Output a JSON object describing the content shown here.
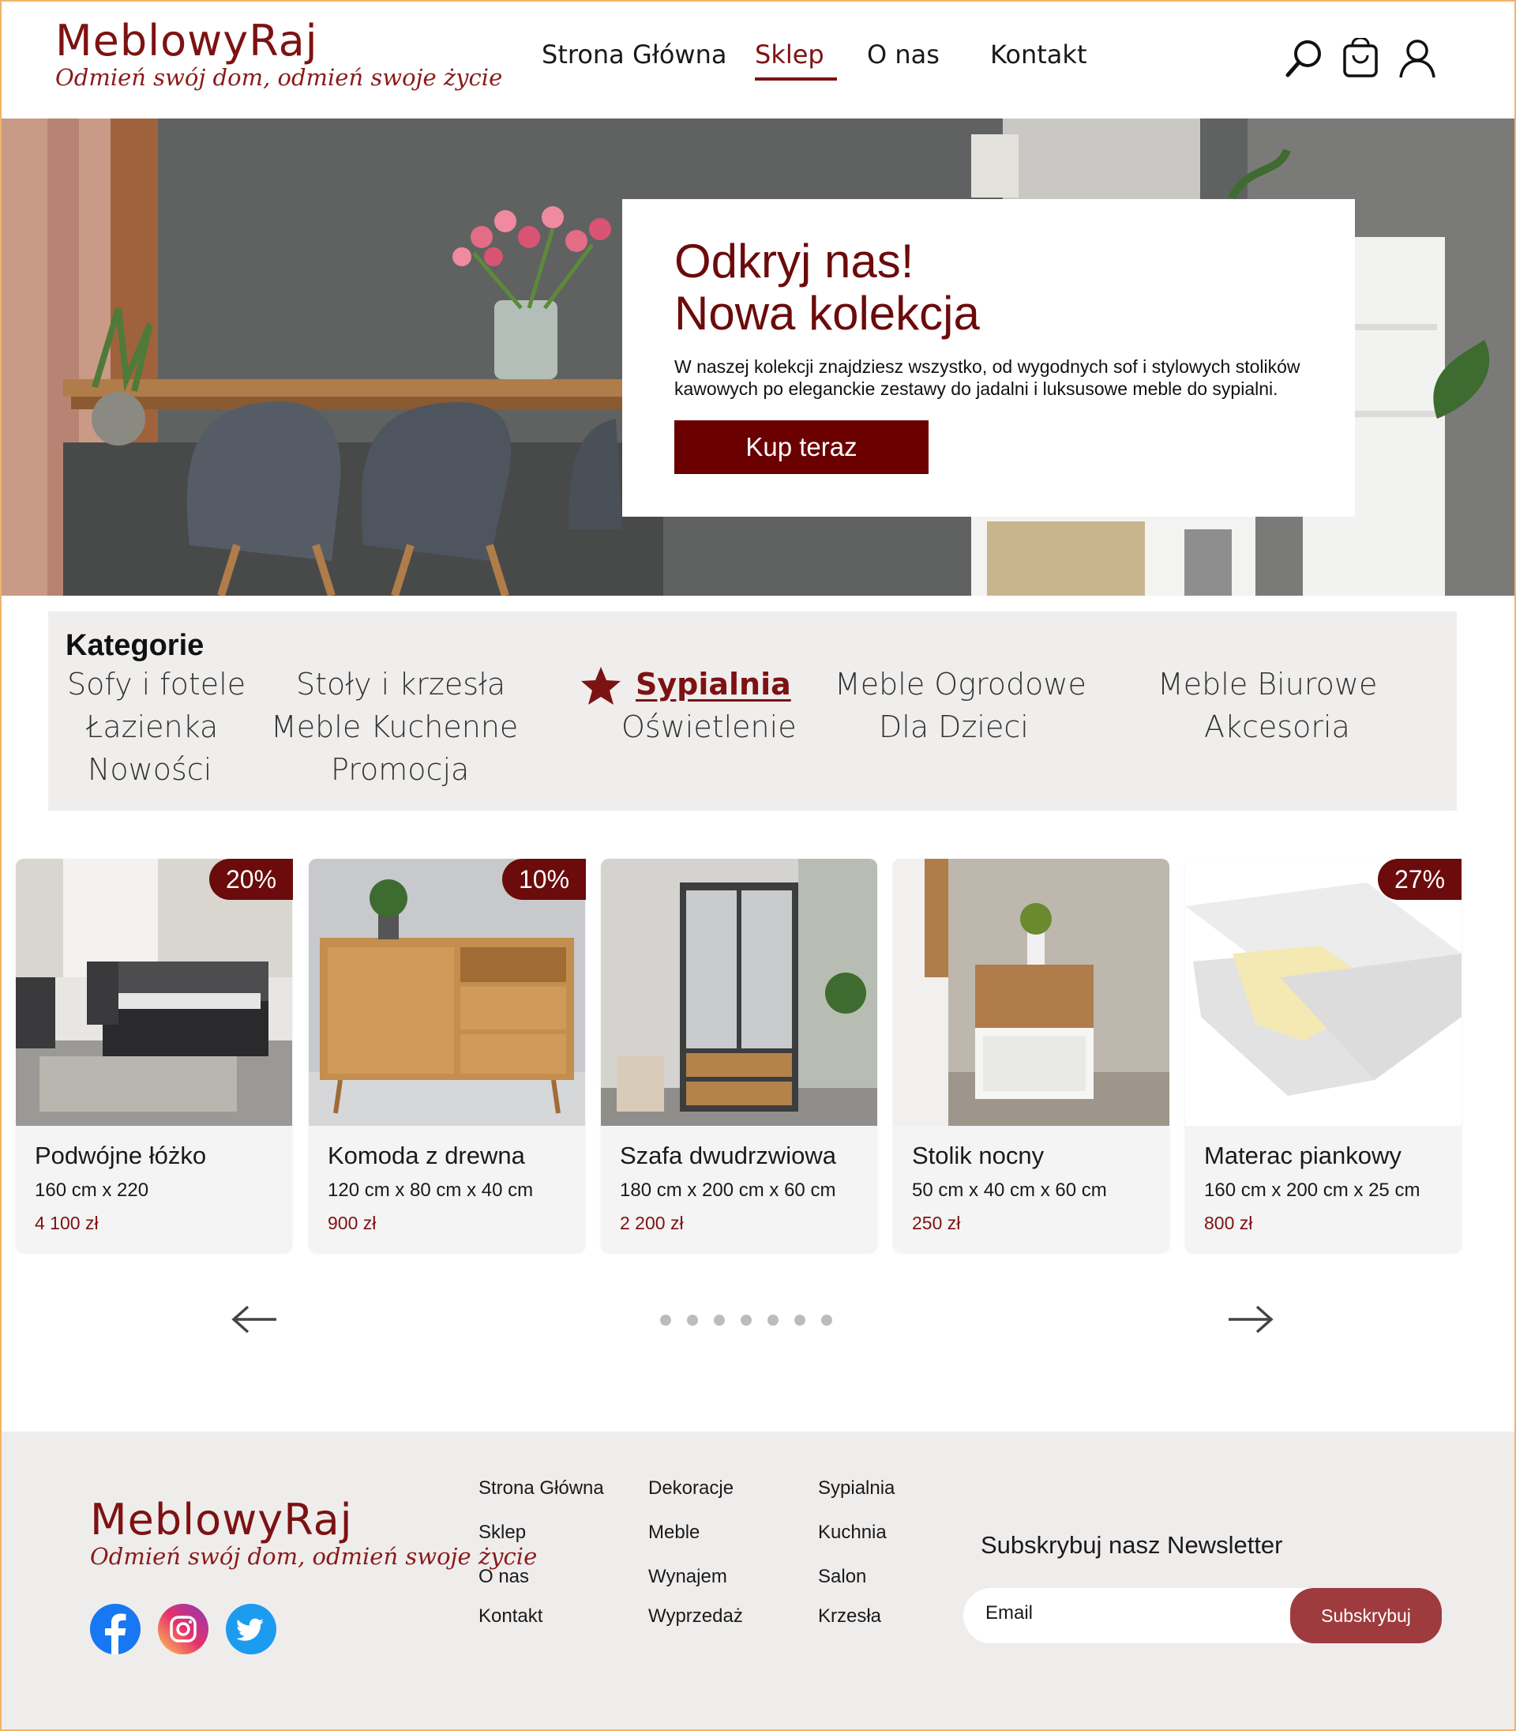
{
  "brand": {
    "name": "MeblowyRaj",
    "tagline": "Odmień swój dom, odmień swoje życie",
    "accent": "#7d1212"
  },
  "nav": {
    "items": [
      "Strona Główna",
      "Sklep",
      "O nas",
      "Kontakt"
    ],
    "active": "Sklep"
  },
  "header_icons": [
    "search-icon",
    "cart-icon",
    "user-icon"
  ],
  "hero": {
    "title_line1": "Odkryj nas!",
    "title_line2": "Nowa kolekcja",
    "text": "W naszej kolekcji znajdziesz wszystko, od wygodnych sof i stylowych stolików kawowych po eleganckie zestawy do jadalni i luksusowe meble do sypialni.",
    "button": "Kup teraz"
  },
  "categories": {
    "title": "Kategorie",
    "items": [
      "Sofy i fotele",
      "Stoły i krzesła",
      "Sypialnia",
      "Meble Ogrodowe",
      "Meble Biurowe",
      "Łazienka",
      "Meble Kuchenne",
      "Oświetlenie",
      "Dla Dzieci",
      "Akcesoria",
      "Nowości",
      "Promocja"
    ],
    "active": "Sypialnia"
  },
  "products": [
    {
      "name": "Podwójne łóżko",
      "dims": "160 cm x 220",
      "price": "4 100 zł",
      "discount": "20%"
    },
    {
      "name": "Komoda z drewna",
      "dims": "120 cm x 80 cm x 40 cm",
      "price": "900 zł",
      "discount": "10%"
    },
    {
      "name": "Szafa dwudrzwiowa",
      "dims": "180 cm x 200 cm x 60 cm",
      "price": "2 200 zł",
      "discount": ""
    },
    {
      "name": "Stolik nocny",
      "dims": "50 cm x 40 cm x 60 cm",
      "price": "250 zł",
      "discount": ""
    },
    {
      "name": "Materac piankowy",
      "dims": "160 cm x 200 cm x 25 cm",
      "price": "800 zł",
      "discount": "27%"
    }
  ],
  "carousel": {
    "dots": 7
  },
  "footer": {
    "col1": [
      "Strona Główna",
      "Sklep",
      "O nas",
      "Kontakt"
    ],
    "col2": [
      "Dekoracje",
      "Meble",
      "Wynajem",
      "Wyprzedaż"
    ],
    "col3": [
      "Sypialnia",
      "Kuchnia",
      "Salon",
      "Krzesła"
    ],
    "newsletter_title": "Subskrybuj nasz Newsletter",
    "email_placeholder": "Email",
    "subscribe": "Subskrybuj",
    "social": [
      "facebook-icon",
      "instagram-icon",
      "twitter-icon"
    ]
  }
}
